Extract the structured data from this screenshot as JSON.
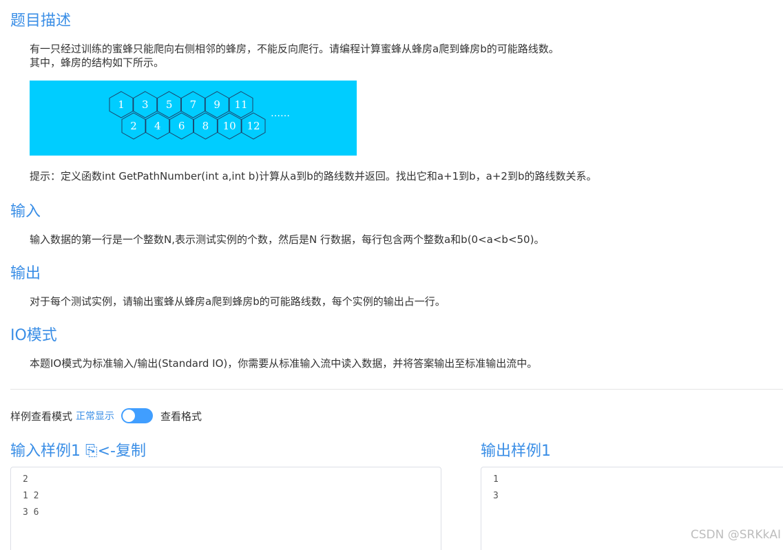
{
  "description": {
    "title": "题目描述",
    "line1": "有一只经过训练的蜜蜂只能爬向右侧相邻的蜂房，不能反向爬行。请编程计算蜜蜂从蜂房a爬到蜂房b的可能路线数。",
    "line2": "其中，蜂房的结构如下所示。",
    "figure": {
      "cells": [
        "1",
        "2",
        "3",
        "4",
        "5",
        "6",
        "7",
        "8",
        "9",
        "10",
        "11",
        "12"
      ],
      "ellipsis": "……",
      "background": "#00cdff"
    },
    "hint": "提示：定义函数int  GetPathNumber(int a,int b)计算从a到b的路线数并返回。找出它和a+1到b，a+2到b的路线数关系。"
  },
  "input": {
    "title": "输入",
    "text": "输入数据的第一行是一个整数N,表示测试实例的个数，然后是N 行数据，每行包含两个整数a和b(0<a<b<50)。"
  },
  "output": {
    "title": "输出",
    "text": "对于每个测试实例，请输出蜜蜂从蜂房a爬到蜂房b的可能路线数，每个实例的输出占一行。"
  },
  "io_mode": {
    "title": "IO模式",
    "text": "本题IO模式为标准输入/输出(Standard IO)，你需要从标准输入流中读入数据，并将答案输出至标准输出流中。"
  },
  "sample_mode": {
    "label": "样例查看模式",
    "normal": "正常显示",
    "format": "查看格式",
    "toggle_color": "#409eff"
  },
  "samples": {
    "input_title": "输入样例1",
    "copy_label": "⎘<-复制",
    "input_lines": [
      "2",
      "1 2",
      "3 6"
    ],
    "output_title": "输出样例1",
    "output_lines": [
      "1",
      "3"
    ]
  },
  "watermark": "CSDN @SRKkAI",
  "accent_color": "#3a8ee6"
}
